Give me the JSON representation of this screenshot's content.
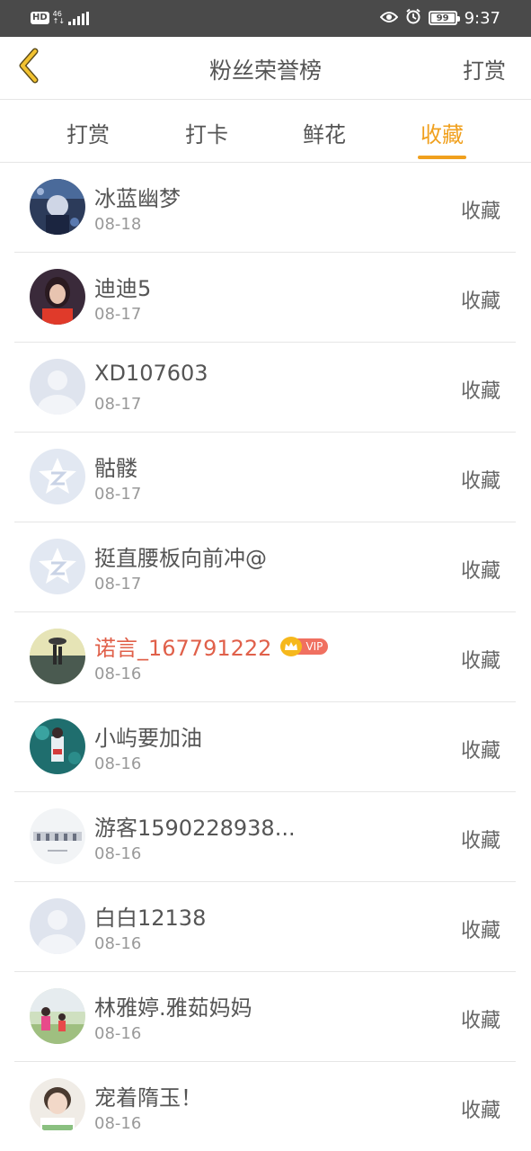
{
  "status_bar": {
    "hd": "HD",
    "network_top": "46",
    "network_bottom": "↑↓",
    "battery": "99",
    "time": "9:37",
    "icons": [
      "eye-icon",
      "alarm-icon",
      "battery-icon",
      "signal-icon"
    ]
  },
  "header": {
    "title": "粉丝荣誉榜",
    "action": "打赏",
    "back_icon": "chevron-left-icon"
  },
  "tabs": [
    {
      "label": "打赏",
      "active": false
    },
    {
      "label": "打卡",
      "active": false
    },
    {
      "label": "鲜花",
      "active": false
    },
    {
      "label": "收藏",
      "active": true
    }
  ],
  "colors": {
    "accent": "#f0a01e",
    "vip_name": "#e0604a",
    "text": "#555555",
    "subtext": "#999999",
    "status_bar": "#4a4a4a"
  },
  "fans": [
    {
      "name": "冰蓝幽梦",
      "date": "08-18",
      "action": "收藏",
      "avatar": "photo-dark-blue"
    },
    {
      "name": "迪迪5",
      "date": "08-17",
      "action": "收藏",
      "avatar": "photo-girl-red"
    },
    {
      "name": "XD107603",
      "date": "08-17",
      "action": "收藏",
      "avatar": "default-person"
    },
    {
      "name": "骷髅",
      "date": "08-17",
      "action": "收藏",
      "avatar": "default-star"
    },
    {
      "name": "挺直腰板向前冲@",
      "date": "08-17",
      "action": "收藏",
      "avatar": "default-star"
    },
    {
      "name": "诺言_167791222",
      "date": "08-16",
      "action": "收藏",
      "avatar": "photo-beach",
      "vip": true,
      "vip_label": "VIP"
    },
    {
      "name": "小屿要加油",
      "date": "08-16",
      "action": "收藏",
      "avatar": "photo-teal"
    },
    {
      "name": "游客1590228938...",
      "date": "08-16",
      "action": "收藏",
      "avatar": "photo-light"
    },
    {
      "name": "白白12138",
      "date": "08-16",
      "action": "收藏",
      "avatar": "default-person"
    },
    {
      "name": "林雅婷.雅茹妈妈",
      "date": "08-16",
      "action": "收藏",
      "avatar": "photo-kids"
    },
    {
      "name": "宠着隋玉！",
      "date": "08-16",
      "action": "收藏",
      "avatar": "photo-child"
    }
  ]
}
